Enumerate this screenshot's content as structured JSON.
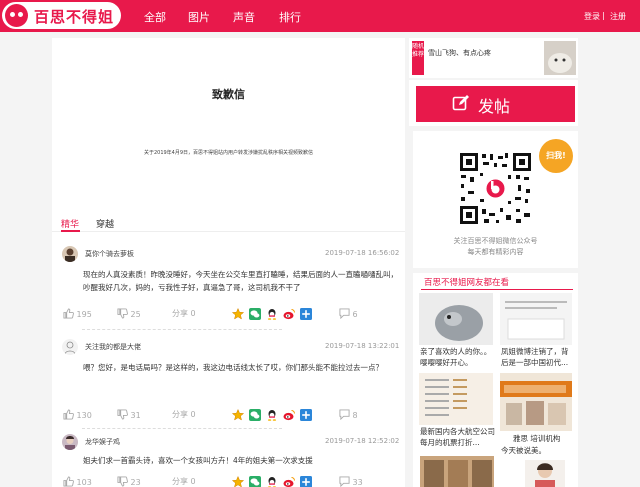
{
  "brand": {
    "name": "百思不得姐",
    "color": "#e8194b"
  },
  "nav": [
    "全部",
    "图片",
    "声音",
    "排行"
  ],
  "auth": {
    "login": "登录",
    "separator": "|",
    "register": "注册"
  },
  "document": {
    "title": "致歉信",
    "text": "关于2019年4月9日，百思不得姐站内用户转发涉嫌扰乱秩序相关视频致歉信"
  },
  "tabs": {
    "active": "精华",
    "other": "穿越"
  },
  "posts": [
    {
      "user": "莫你个骑去萝板",
      "time": "2019-07-18 16:56:02",
      "text": "现在的人真没素质！昨晚没睡好，今天坐在公交车里直打瞌睡，结果后面的人一直瞌嗵嗵乱叫，吵醒我好几次，妈的，亏我性子好，真逼急了哥，这司机我不干了",
      "likes": "195",
      "dislikes": "25",
      "share": "分享",
      "shares": "0",
      "comments": "6"
    },
    {
      "user": "关注我的都是大佬",
      "time": "2019-07-18 13:22:01",
      "text": "喂？您好，是电话局吗？是这样的，我这边电话线太长了哎，你们那头能不能拉过去一点？",
      "likes": "130",
      "dislikes": "31",
      "share": "分享",
      "shares": "0",
      "comments": "8"
    },
    {
      "user": "龙华娱子鸡",
      "time": "2019-07-18 12:52:02",
      "text": "姐夫们求一首霸头诗，喜欢一个女孩叫方卉！4年的姐夫第一次求支援",
      "likes": "103",
      "dislikes": "23",
      "share": "分享",
      "shares": "0",
      "comments": "33"
    }
  ],
  "sidebar": {
    "hot_tag": "随机推荐",
    "hot_text": "雪山飞狗、有点心疼",
    "post_button": "发帖",
    "scan_label": "扫我!",
    "qr_caption_1": "关注百思不得姐微信公众号",
    "qr_caption_2": "每天都有精彩内容",
    "rec_title": "百思不得姐网友都在看",
    "rec_items": [
      {
        "caption": "亲了喜欢的人的你。。嘤嘤嘤好开心。"
      },
      {
        "caption": "凤姐微博注销了，背后是一部中国初代..."
      },
      {
        "caption": "最新国内各大航空公司每月的机票打折..."
      },
      {
        "caption": "雅思 培训机构"
      },
      {
        "caption": "今天被说美。"
      }
    ]
  },
  "icons": [
    "like-icon",
    "dislike-icon",
    "share-icon",
    "comment-icon",
    "qzone-icon",
    "wechat-icon",
    "qq-icon",
    "weibo-icon",
    "plus-icon",
    "edit-icon"
  ]
}
